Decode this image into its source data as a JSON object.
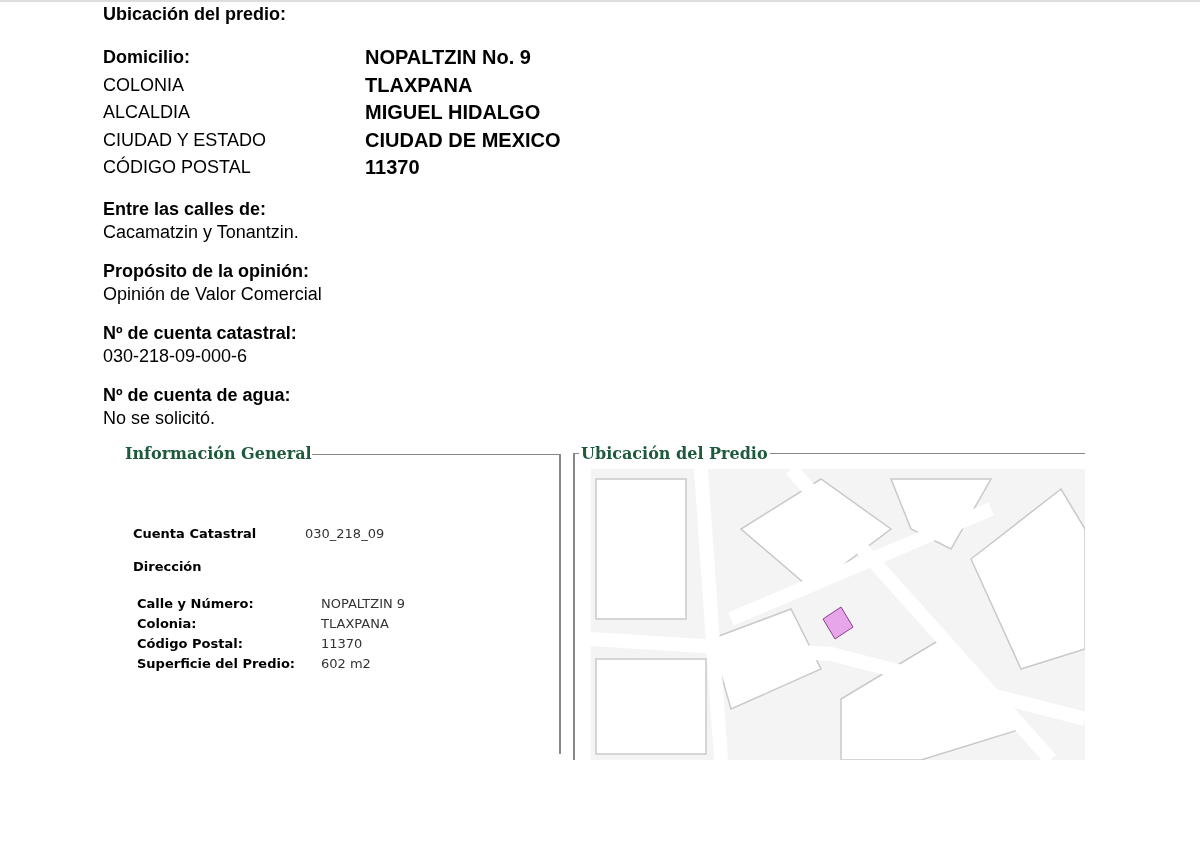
{
  "heading": "Ubicación del predio:",
  "address": [
    {
      "label": "Domicilio:",
      "value": "NOPALTZIN No. 9",
      "kind": "bold"
    },
    {
      "label": "COLONIA",
      "value": "TLAXPANA",
      "kind": "plain"
    },
    {
      "label": "ALCALDIA",
      "value": "MIGUEL HIDALGO",
      "kind": "plain"
    },
    {
      "label": "CIUDAD Y ESTADO",
      "value": "CIUDAD DE MEXICO",
      "kind": "plain"
    },
    {
      "label": "CÓDIGO POSTAL",
      "value": "11370",
      "kind": "plain"
    }
  ],
  "sections": [
    {
      "title": "Entre las calles de:",
      "text": "Cacamatzin y Tonantzin."
    },
    {
      "title": "Propósito de la opinión:",
      "text": "Opinión de Valor Comercial"
    },
    {
      "title": "Nº de cuenta catastral:",
      "text": "030-218-09-000-6"
    },
    {
      "title": "Nº de cuenta de agua:",
      "text": "No se solicitó."
    }
  ],
  "info_panel": {
    "title": "Información General",
    "account_label": "Cuenta Catastral",
    "account_value": "030_218_09",
    "address_heading": "Dirección",
    "fields": [
      {
        "label": "Calle y Número:",
        "value": "NOPALTZIN 9"
      },
      {
        "label": "Colonia:",
        "value": "TLAXPANA"
      },
      {
        "label": "Código Postal:",
        "value": "11370"
      },
      {
        "label": "Superficie del Predio:",
        "value": "602 m2"
      }
    ]
  },
  "map_panel": {
    "title": "Ubicación del Predio"
  }
}
